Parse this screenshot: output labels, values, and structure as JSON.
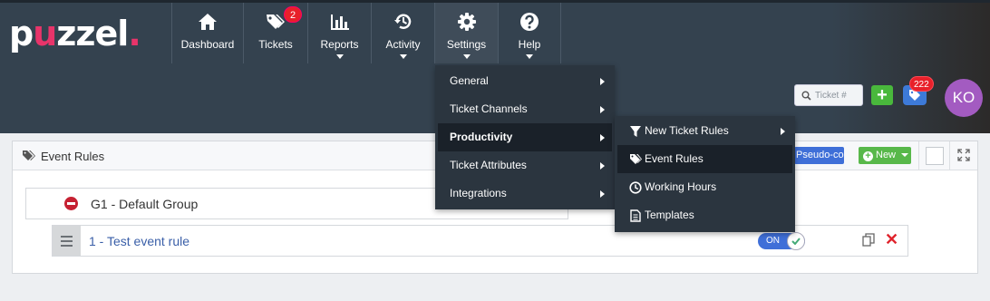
{
  "brand": {
    "logo_pre": "p",
    "logo_u": "u",
    "logo_post": "zzel",
    "logo_dot": "."
  },
  "nav": {
    "dashboard": "Dashboard",
    "tickets": "Tickets",
    "tickets_badge": "2",
    "reports": "Reports",
    "activity": "Activity",
    "settings": "Settings",
    "help": "Help"
  },
  "header_tools": {
    "ticket_search_placeholder": "Ticket #",
    "add_label": "+",
    "tag_badge": "222",
    "avatar_initials": "KO"
  },
  "settings_menu": {
    "general": "General",
    "ticket_channels": "Ticket Channels",
    "productivity": "Productivity",
    "ticket_attributes": "Ticket Attributes",
    "integrations": "Integrations"
  },
  "productivity_menu": {
    "new_ticket_rules": "New Ticket Rules",
    "event_rules": "Event Rules",
    "working_hours": "Working Hours",
    "templates": "Templates"
  },
  "panel": {
    "title": "Event Rules",
    "pseudo_code_button": "Pseudo-code",
    "new_button": "New",
    "group": {
      "label": "G1 - Default Group"
    },
    "rule": {
      "label": "1 - Test event rule",
      "toggle": "ON"
    }
  },
  "colors": {
    "topbar": "#34424f",
    "brand_accent": "#e8346a",
    "menu_bg": "#2b353f",
    "primary_blue": "#3f6fd8",
    "green": "#58b84a",
    "danger": "#e0242d",
    "avatar": "#a35bc1"
  }
}
